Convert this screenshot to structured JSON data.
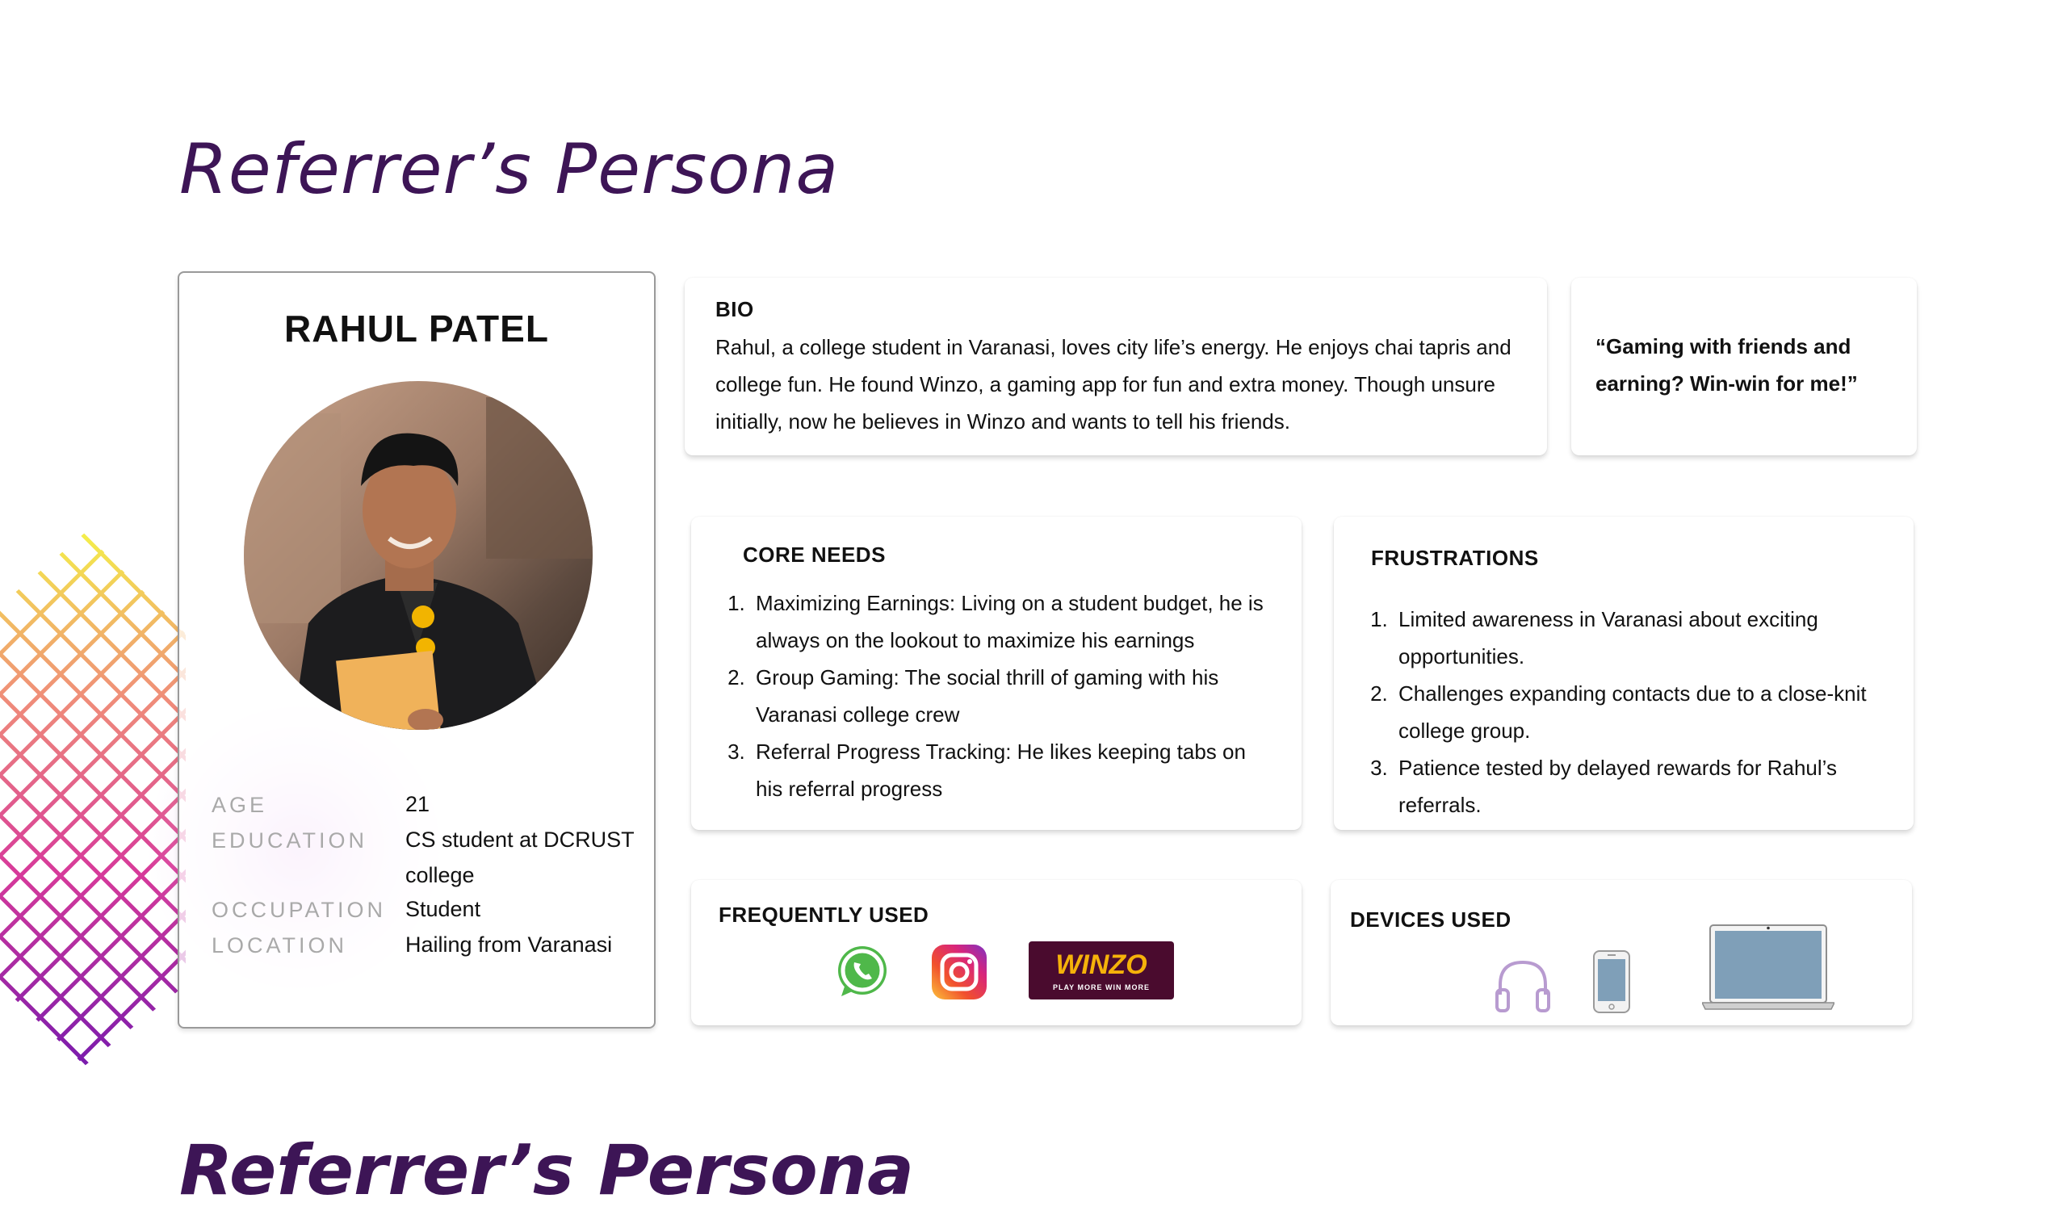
{
  "page": {
    "title": "Referrer’s Persona",
    "next_title": "Referrer’s Persona"
  },
  "profile": {
    "name": "RAHUL PATEL",
    "fields": [
      {
        "label": "AGE",
        "value": "21"
      },
      {
        "label": "EDUCATION",
        "value": "CS student at DCRUST college"
      },
      {
        "label": "OCCUPATION",
        "value": "Student"
      },
      {
        "label": "LOCATION",
        "value": "Hailing from Varanasi"
      }
    ]
  },
  "bio": {
    "heading": "BIO",
    "text": "Rahul, a college student in Varanasi, loves city life’s energy. He enjoys chai tapris and college fun. He found Winzo, a gaming app for fun and extra money. Though unsure initially, now he believes in Winzo and wants to tell his friends."
  },
  "quote": {
    "text": "“Gaming with friends and earning? Win-win for me!”"
  },
  "core_needs": {
    "heading": "CORE NEEDS",
    "items": [
      "Maximizing Earnings: Living on a student budget, he is always on the lookout to maximize his earnings",
      "Group Gaming: The social thrill of gaming with his Varanasi college crew",
      "Referral Progress Tracking: He likes keeping tabs on his referral progress"
    ]
  },
  "frustrations": {
    "heading": "FRUSTRATIONS",
    "items": [
      "Limited awareness in Varanasi about exciting opportunities.",
      "Challenges expanding contacts due to a close-knit college group.",
      "Patience tested by delayed rewards for Rahul’s referrals."
    ]
  },
  "frequently_used": {
    "heading": "FREQUENTLY USED",
    "apps": [
      {
        "icon": "whatsapp-icon"
      },
      {
        "icon": "instagram-icon"
      },
      {
        "icon": "winzo-logo",
        "logo_text": "WINZO",
        "tagline": "PLAY MORE WIN MORE"
      }
    ]
  },
  "devices_used": {
    "heading": "DEVICES USED",
    "devices": [
      {
        "icon": "headphones-icon"
      },
      {
        "icon": "smartphone-icon"
      },
      {
        "icon": "laptop-icon"
      }
    ]
  },
  "colors": {
    "title_purple": "#3d1556",
    "label_gray": "#a9a9a9",
    "device_screen": "#7f9fb8",
    "winzo_bg": "#4a0b2e",
    "winzo_text": "#f5b20a"
  }
}
